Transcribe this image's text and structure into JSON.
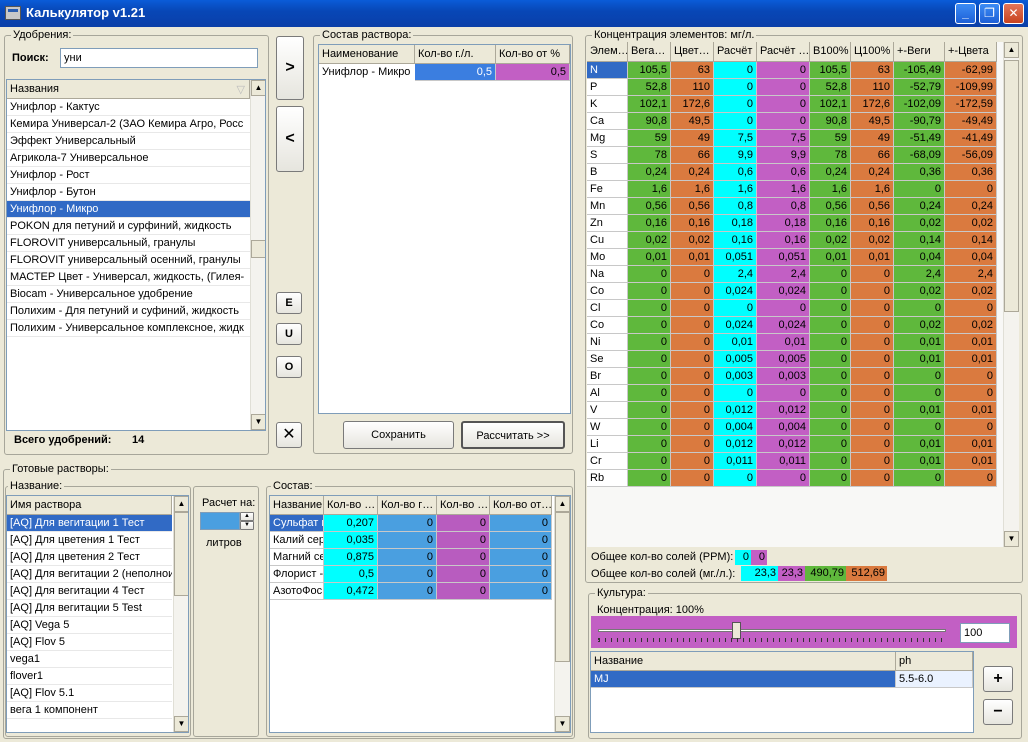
{
  "window": {
    "title": "Калькулятор v1.21",
    "minimize": "_",
    "maximize": "❐",
    "close": "✕"
  },
  "fert": {
    "legend": "Удобрения:",
    "search_label": "Поиск:",
    "search_value": "уни",
    "col_header": "Названия",
    "items": [
      "Унифлор - Кактус",
      "Кемира Универсал-2  (ЗАО Кемира Агро, Росс",
      "Эффект Универсальный",
      "Агрикола-7 Универсальное",
      "Унифлор - Рост",
      "Унифлор - Бутон",
      "Унифлор - Микро",
      "POKON для петуний и сурфиний, жидкость",
      "FLOROVIT универсальный, гранулы",
      "FLOROVIT универсальный осенний, гранулы",
      "МАСТЕР Цвет - Универсал, жидкость,  (Гилея-",
      "Biocam - Универсальное удобрение",
      "Полихим - Для петуний и суфиний, жидкость",
      "Полихим - Универсальное комплексное, жидк"
    ],
    "selected_index": 6,
    "total_label": "Всего удобрений:",
    "total_value": "14"
  },
  "mid_buttons": {
    "add": ">",
    "remove": "<",
    "e": "E",
    "u": "U",
    "o": "O",
    "clear": "✕"
  },
  "solution": {
    "legend": "Состав раствора:",
    "headers": [
      "Наименование",
      "Кол-во г./л.",
      "Кол-во от %"
    ],
    "row": {
      "name": "Унифлор - Микро",
      "gl": "0,5",
      "pct": "0,5"
    },
    "save": "Сохранить",
    "calc": "Рассчитать >>"
  },
  "conc": {
    "legend": "Концентрация элементов: мг/л.",
    "headers": [
      "Элем…",
      "Вега…",
      "Цвет…",
      "Расчёт",
      "Расчёт …",
      "В100%",
      "Ц100%",
      "+-Веги",
      "+-Цвета"
    ],
    "rows": [
      [
        "N",
        "105,5",
        "63",
        "0",
        "0",
        "105,5",
        "63",
        "-105,49",
        "-62,99"
      ],
      [
        "P",
        "52,8",
        "110",
        "0",
        "0",
        "52,8",
        "110",
        "-52,79",
        "-109,99"
      ],
      [
        "K",
        "102,1",
        "172,6",
        "0",
        "0",
        "102,1",
        "172,6",
        "-102,09",
        "-172,59"
      ],
      [
        "Ca",
        "90,8",
        "49,5",
        "0",
        "0",
        "90,8",
        "49,5",
        "-90,79",
        "-49,49"
      ],
      [
        "Mg",
        "59",
        "49",
        "7,5",
        "7,5",
        "59",
        "49",
        "-51,49",
        "-41,49"
      ],
      [
        "S",
        "78",
        "66",
        "9,9",
        "9,9",
        "78",
        "66",
        "-68,09",
        "-56,09"
      ],
      [
        "B",
        "0,24",
        "0,24",
        "0,6",
        "0,6",
        "0,24",
        "0,24",
        "0,36",
        "0,36"
      ],
      [
        "Fe",
        "1,6",
        "1,6",
        "1,6",
        "1,6",
        "1,6",
        "1,6",
        "0",
        "0"
      ],
      [
        "Mn",
        "0,56",
        "0,56",
        "0,8",
        "0,8",
        "0,56",
        "0,56",
        "0,24",
        "0,24"
      ],
      [
        "Zn",
        "0,16",
        "0,16",
        "0,18",
        "0,18",
        "0,16",
        "0,16",
        "0,02",
        "0,02"
      ],
      [
        "Cu",
        "0,02",
        "0,02",
        "0,16",
        "0,16",
        "0,02",
        "0,02",
        "0,14",
        "0,14"
      ],
      [
        "Mo",
        "0,01",
        "0,01",
        "0,051",
        "0,051",
        "0,01",
        "0,01",
        "0,04",
        "0,04"
      ],
      [
        "Na",
        "0",
        "0",
        "2,4",
        "2,4",
        "0",
        "0",
        "2,4",
        "2,4"
      ],
      [
        "Co",
        "0",
        "0",
        "0,024",
        "0,024",
        "0",
        "0",
        "0,02",
        "0,02"
      ],
      [
        "Cl",
        "0",
        "0",
        "0",
        "0",
        "0",
        "0",
        "0",
        "0"
      ],
      [
        "Co",
        "0",
        "0",
        "0,024",
        "0,024",
        "0",
        "0",
        "0,02",
        "0,02"
      ],
      [
        "Ni",
        "0",
        "0",
        "0,01",
        "0,01",
        "0",
        "0",
        "0,01",
        "0,01"
      ],
      [
        "Se",
        "0",
        "0",
        "0,005",
        "0,005",
        "0",
        "0",
        "0,01",
        "0,01"
      ],
      [
        "Br",
        "0",
        "0",
        "0,003",
        "0,003",
        "0",
        "0",
        "0",
        "0"
      ],
      [
        "Al",
        "0",
        "0",
        "0",
        "0",
        "0",
        "0",
        "0",
        "0"
      ],
      [
        "V",
        "0",
        "0",
        "0,012",
        "0,012",
        "0",
        "0",
        "0,01",
        "0,01"
      ],
      [
        "W",
        "0",
        "0",
        "0,004",
        "0,004",
        "0",
        "0",
        "0",
        "0"
      ],
      [
        "Li",
        "0",
        "0",
        "0,012",
        "0,012",
        "0",
        "0",
        "0,01",
        "0,01"
      ],
      [
        "Cr",
        "0",
        "0",
        "0,011",
        "0,011",
        "0",
        "0",
        "0,01",
        "0,01"
      ],
      [
        "Rb",
        "0",
        "0",
        "0",
        "0",
        "0",
        "0",
        "0",
        "0"
      ]
    ],
    "ppm_label": "Общее кол-во солей (PPM):",
    "ppm_values": [
      "0",
      "0"
    ],
    "mgl_label": "Общее кол-во солей (мг./л.):",
    "mgl_values": [
      "23,3",
      "23,3",
      "490,79",
      "512,69"
    ]
  },
  "ready": {
    "legend": "Готовые растворы:",
    "name_legend": "Название:",
    "col_header": "Имя раствора",
    "items": [
      "[AQ] Для вегитации 1 Тест",
      "[AQ] Для цветения 1 Тест",
      "[AQ] Для цветения 2 Тест",
      "[AQ] Для вегитации 2 (неполнoи",
      "[AQ] Для вегитации 4 Тест",
      "[AQ] Для вегитации 5 Test",
      "[AQ] Vega 5",
      "[AQ] Flov 5",
      "vega1",
      "flover1",
      "[AQ] Flov 5.1",
      "вега 1 компонент"
    ],
    "selected_index": 0,
    "calc_label": "Расчет на:",
    "liters_label": "литров",
    "liters_value": ""
  },
  "compos": {
    "legend": "Состав:",
    "headers": [
      "Название",
      "Кол-во …",
      "Кол-во г…",
      "Кол-во …",
      "Кол-во от…"
    ],
    "rows": [
      [
        "Сульфат м",
        "0,207",
        "0",
        "0",
        "0"
      ],
      [
        "Калий  сер",
        "0,035",
        "0",
        "0",
        "0"
      ],
      [
        "Магний се",
        "0,875",
        "0",
        "0",
        "0"
      ],
      [
        "Флорист -",
        "0,5",
        "0",
        "0",
        "0"
      ],
      [
        "АзотоФос",
        "0,472",
        "0",
        "0",
        "0"
      ]
    ]
  },
  "culture": {
    "legend": "Культура:",
    "conc_label": "Концентрация: 100%",
    "slider_value": "100",
    "headers": [
      "Название",
      "ph"
    ],
    "row": {
      "name": "MJ",
      "ph": "5.5-6.0"
    },
    "plus": "+",
    "minus": "−"
  }
}
